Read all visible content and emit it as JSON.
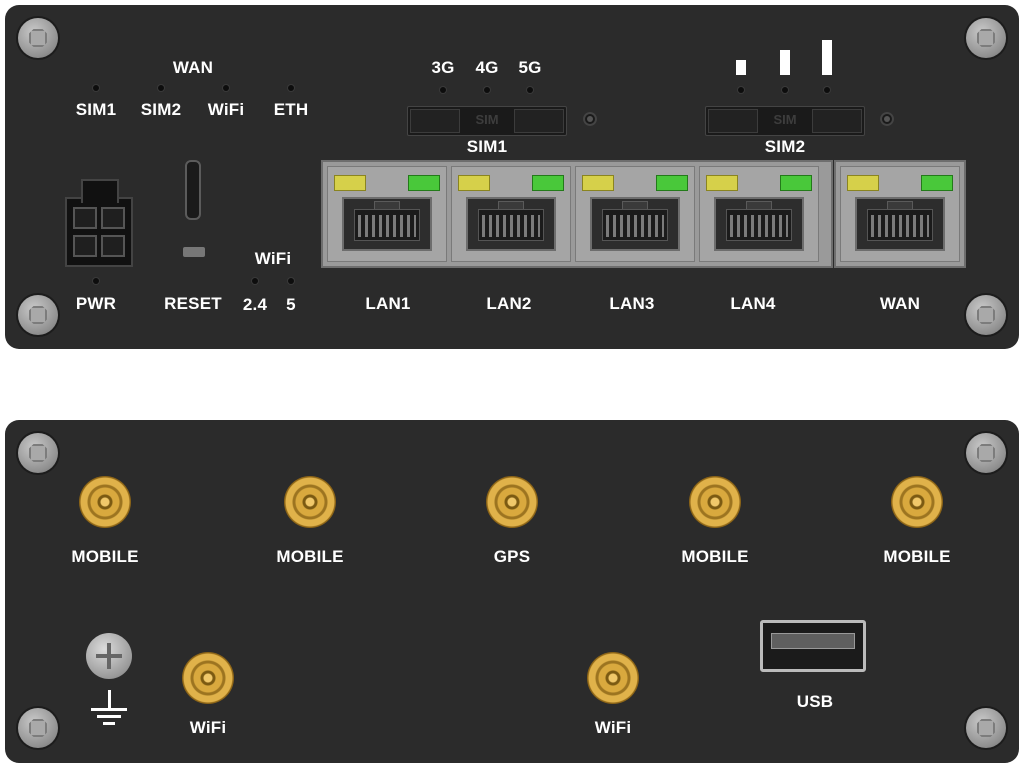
{
  "front_panel": {
    "led_labels": {
      "wan_title": "WAN",
      "sim1": "SIM1",
      "sim2": "SIM2",
      "wifi": "WiFi",
      "eth": "ETH",
      "g3": "3G",
      "g4": "4G",
      "g5": "5G",
      "wifi_title": "WiFi",
      "wifi_24": "2.4",
      "wifi_5": "5"
    },
    "sim_slot_labels": {
      "slot1": "SIM1",
      "slot2": "SIM2",
      "slot_print": "SIM"
    },
    "power_label": "PWR",
    "reset_label": "RESET",
    "port_labels": [
      "LAN1",
      "LAN2",
      "LAN3",
      "LAN4",
      "WAN"
    ],
    "signal_bars": 3
  },
  "rear_panel": {
    "antenna_labels": [
      "MOBILE",
      "MOBILE",
      "GPS",
      "MOBILE",
      "MOBILE"
    ],
    "wifi_left": "WiFi",
    "wifi_right": "WiFi",
    "usb_label": "USB",
    "ground_icon": "ground-icon"
  },
  "colors": {
    "panel": "#2b2b2b",
    "led_yellow": "#d6d04a",
    "led_green": "#49c83a",
    "sma_gold": "#d9a93e",
    "text": "#ffffff"
  }
}
